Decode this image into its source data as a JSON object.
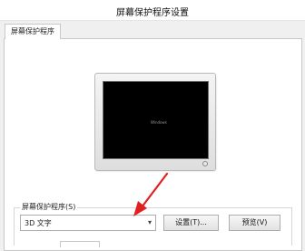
{
  "window": {
    "title": "屏幕保护程序设置"
  },
  "tabs": [
    {
      "label": "屏幕保护程序"
    }
  ],
  "preview": {
    "screen_text": "Windows"
  },
  "screensaver": {
    "group_label": "屏幕保护程序(S)",
    "selected": "3D 文字",
    "settings_label": "设置(T)...",
    "preview_label": "预览(V)"
  },
  "annotation": {
    "arrow_color": "#e02020"
  }
}
